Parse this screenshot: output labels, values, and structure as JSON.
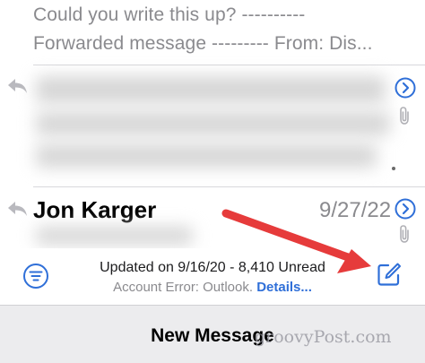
{
  "messages": [
    {
      "preview_line1": "Could you write this up? ----------",
      "preview_line2": "Forwarded message --------- From: Dis..."
    },
    {
      "blurred": true
    },
    {
      "sender": "Jon Karger",
      "date": "9/27/22"
    }
  ],
  "toolbar": {
    "status": "Updated on 9/16/20 - 8,410 Unread",
    "error_text": "Account Error: Outlook.",
    "details_link": "Details..."
  },
  "sheet": {
    "title": "New Message"
  },
  "watermark": "groovyPost.com",
  "icons": {
    "reply": "reply-icon",
    "chevron": "chevron-right-circle-icon",
    "attachment": "paperclip-icon",
    "filter": "filter-icon",
    "compose": "compose-icon",
    "annotation": "red-arrow"
  },
  "colors": {
    "accent": "#2f6fd8",
    "annotation_arrow": "#e63b3b",
    "secondary_text": "#8a8a8e"
  }
}
